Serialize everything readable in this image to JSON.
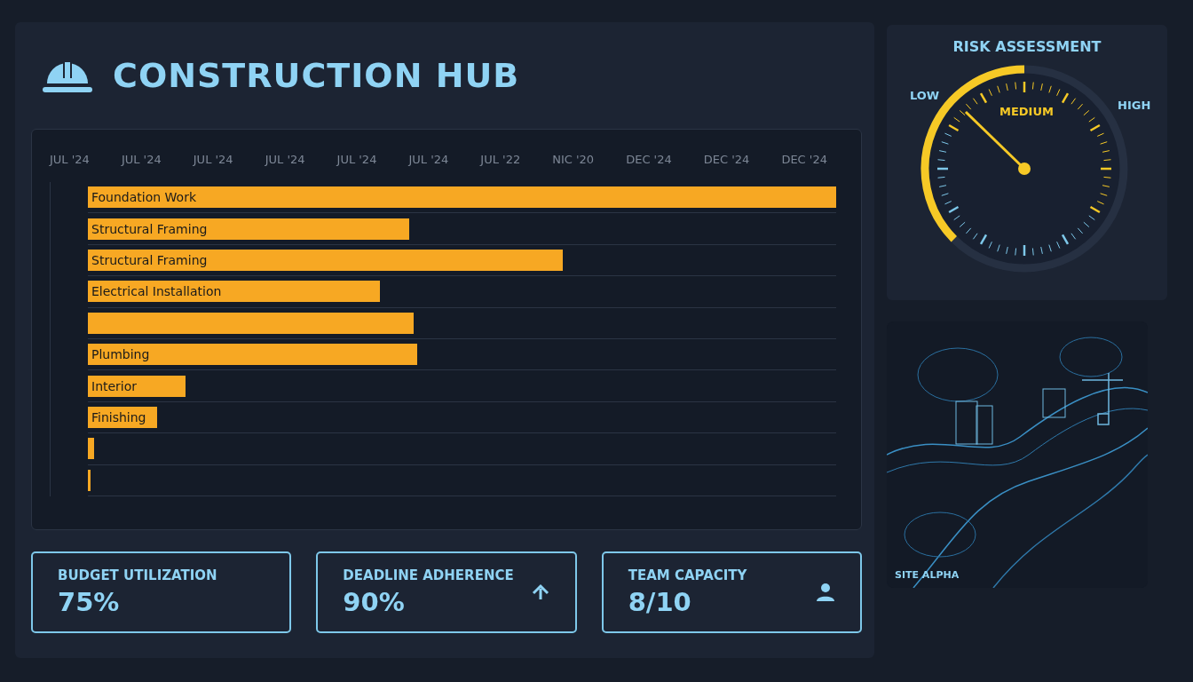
{
  "header": {
    "title": "CONSTRUCTION HUB"
  },
  "timeline": {
    "ticks": [
      "JUL '24",
      "JUL '24",
      "JUL '24",
      "JUL '24",
      "JUL '24",
      "JUL '24",
      "JUL '22",
      "NIC '20",
      "DEC '24",
      "DEC '24",
      "DEC '24"
    ],
    "rows": [
      {
        "label": "Foundation Work",
        "level": 1.0
      },
      {
        "label": "Structural Framing",
        "level": 0.43
      },
      {
        "label": "Structural Framing",
        "level": 0.635
      },
      {
        "label": "Electrical Installation",
        "level": 0.39
      },
      {
        "level": 0.435
      },
      {
        "label": "Plumbing",
        "level": 0.44
      },
      {
        "label": "Interior",
        "level": 0.13
      },
      {
        "label": "Finishing",
        "level": 0.092
      },
      {
        "level": 0.008
      },
      {
        "level": 0.004
      }
    ]
  },
  "risk": {
    "title": "RISK ASSESSMENT",
    "low": "LOW",
    "medium": "MEDIUM",
    "high": "HIGH"
  },
  "site": {
    "label": "SITE ALPHA"
  },
  "kpis": [
    {
      "label": "BUDGET UTILIZATION",
      "value": "75%"
    },
    {
      "label": "DEADLINE ADHERENCE",
      "value": "90%"
    },
    {
      "label": "TEAM CAPACITY",
      "value": "8/10"
    }
  ]
}
